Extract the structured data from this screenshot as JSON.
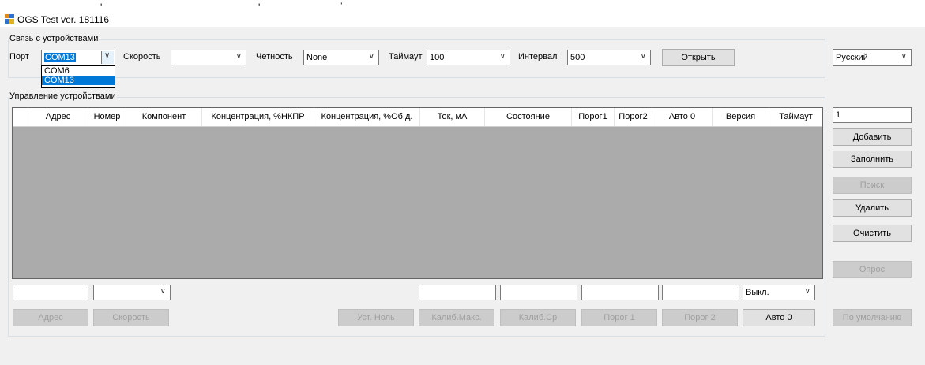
{
  "window": {
    "title": "OGS Test ver. 181116"
  },
  "stray_marks": [
    "'",
    "'",
    "\""
  ],
  "connection": {
    "group_title": "Связь с устройствами",
    "port_label": "Порт",
    "port_value": "COM13",
    "port_options": [
      "COM6",
      "COM13"
    ],
    "speed_label": "Скорость",
    "speed_value": "",
    "parity_label": "Четность",
    "parity_value": "None",
    "timeout_label": "Таймаут",
    "timeout_value": "100",
    "interval_label": "Интервал",
    "interval_value": "500",
    "open_button": "Открыть"
  },
  "language": {
    "value": "Русский"
  },
  "devices": {
    "group_title": "Управление устройствами",
    "columns": [
      "Адрес",
      "Номер",
      "Компонент",
      "Концентрация, %НКПР",
      "Концентрация, %Об.д.",
      "Ток, мА",
      "Состояние",
      "Порог1",
      "Порог2",
      "Авто 0",
      "Версия",
      "Таймаут"
    ],
    "count_value": "1",
    "buttons": {
      "add": "Добавить",
      "fill": "Заполнить",
      "search": "Поиск",
      "delete": "Удалить",
      "clear": "Очистить",
      "poll": "Опрос"
    },
    "bottom": {
      "address_value": "",
      "speed_value": "",
      "auto0_select": "Выкл.",
      "address_button": "Адрес",
      "speed_button": "Скорость",
      "set_zero_button": "Уст. Ноль",
      "calib_max_button": "Калиб.Макс.",
      "calib_avg_button": "Калиб.Ср",
      "threshold1_button": "Порог 1",
      "threshold2_button": "Порог 2",
      "auto0_button": "Авто 0",
      "default_button": "По умолчанию"
    }
  }
}
